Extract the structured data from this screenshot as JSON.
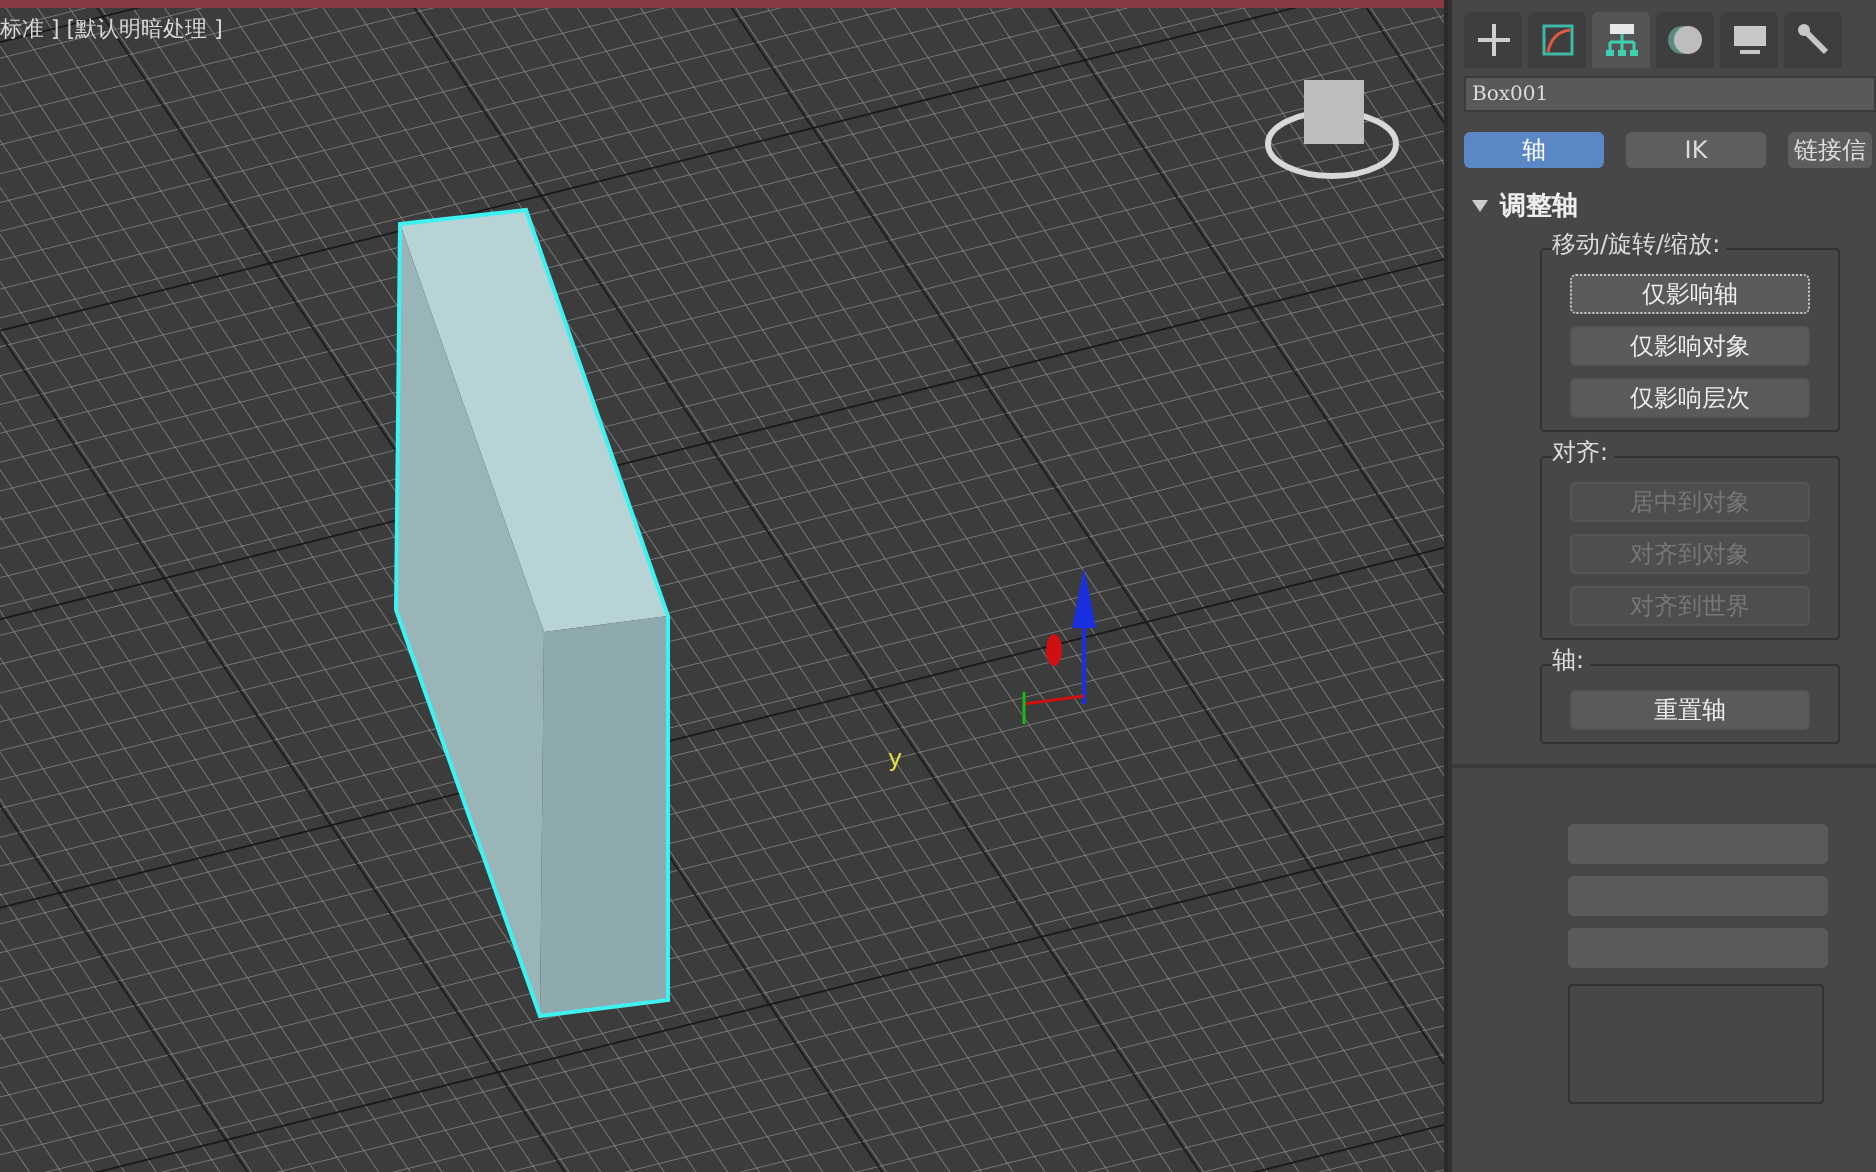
{
  "viewport": {
    "label": "标准 ] [默认明暗处理 ]",
    "axis_label": "y"
  },
  "command_panel": {
    "tabs": [
      {
        "kind": "create",
        "selected": false
      },
      {
        "kind": "modify",
        "selected": false
      },
      {
        "kind": "hierarchy",
        "selected": true
      },
      {
        "kind": "motion",
        "selected": false
      },
      {
        "kind": "display",
        "selected": false
      },
      {
        "kind": "utilities",
        "selected": false
      }
    ],
    "object_name": "Box001",
    "mode_buttons": [
      {
        "label": "轴",
        "selected": true
      },
      {
        "label": "IK",
        "selected": false
      },
      {
        "label": "链接信",
        "selected": false
      }
    ],
    "rollout": {
      "title": "调整轴",
      "expanded": true,
      "groups": [
        {
          "title": "移动/旋转/缩放:",
          "buttons": [
            {
              "label": "仅影响轴",
              "focused": true,
              "disabled": false
            },
            {
              "label": "仅影响对象",
              "focused": false,
              "disabled": false
            },
            {
              "label": "仅影响层次",
              "focused": false,
              "disabled": false
            }
          ]
        },
        {
          "title": "对齐:",
          "buttons": [
            {
              "label": "居中到对象",
              "focused": false,
              "disabled": true
            },
            {
              "label": "对齐到对象",
              "focused": false,
              "disabled": true
            },
            {
              "label": "对齐到世界",
              "focused": false,
              "disabled": true
            }
          ]
        },
        {
          "title": "轴:",
          "buttons": [
            {
              "label": "重置轴",
              "focused": false,
              "disabled": false
            }
          ]
        }
      ]
    }
  }
}
